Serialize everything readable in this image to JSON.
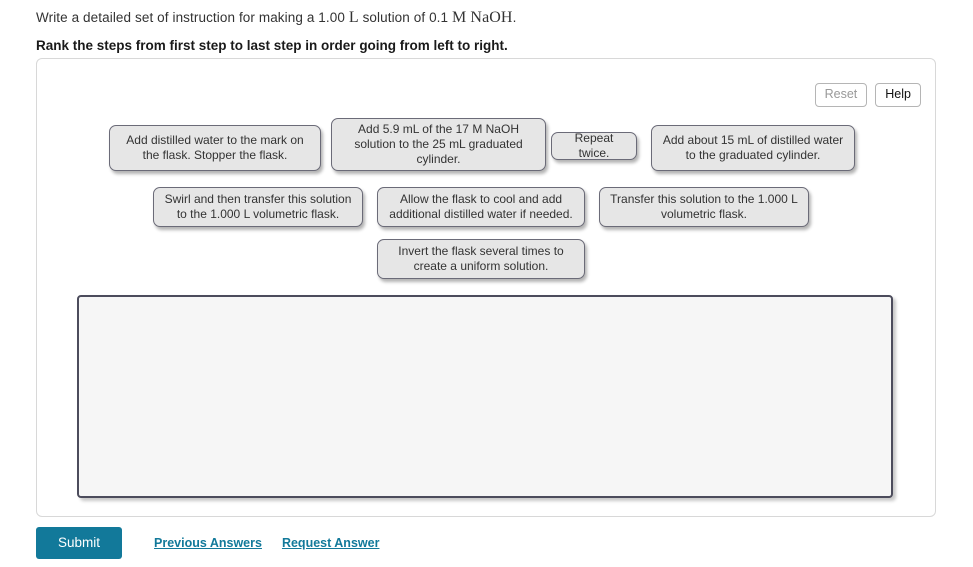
{
  "question": {
    "lead_text": "Write a detailed set of instruction for making a ",
    "volume_value": "1.00",
    "volume_unit": "L",
    "middle_text": " solution of ",
    "concentration_value": "0.1",
    "concentration_unit": "M NaOH",
    "end_text": ".",
    "full_text": "Write a detailed set of instruction for making a 1.00 L solution of 0.1 M NaOH.",
    "instruction": "Rank the steps from first step to last step in order going from left to right."
  },
  "panel": {
    "reset_label": "Reset",
    "help_label": "Help"
  },
  "item_bank": {
    "items": [
      {
        "id": "item-0",
        "text": "Add distilled water to the mark on the flask. Stopper the flask."
      },
      {
        "id": "item-1",
        "text": "Add 5.9 mL of the 17 M NaOH solution to the 25 mL graduated cylinder."
      },
      {
        "id": "item-2",
        "text": "Repeat twice."
      },
      {
        "id": "item-3",
        "text": "Add about 15 mL of distilled water to the graduated cylinder."
      },
      {
        "id": "item-4",
        "text": "Swirl and then transfer this solution to the 1.000 L volumetric flask."
      },
      {
        "id": "item-5",
        "text": "Allow the flask to cool and add additional distilled water if needed."
      },
      {
        "id": "item-6",
        "text": "Transfer this solution to the 1.000 L volumetric flask."
      },
      {
        "id": "item-7",
        "text": "Invert the flask several times to create a uniform solution."
      }
    ]
  },
  "drop_zone": {
    "placed_items": []
  },
  "actions": {
    "submit_label": "Submit",
    "previous_answers_label": "Previous Answers",
    "request_answer_label": "Request Answer"
  },
  "colors": {
    "accent_teal": "#12799a",
    "item_background": "#e6e6e6",
    "item_border": "#6b6b78",
    "drop_zone_border": "#4c4c5c",
    "drop_zone_background": "#f6f6f6"
  }
}
